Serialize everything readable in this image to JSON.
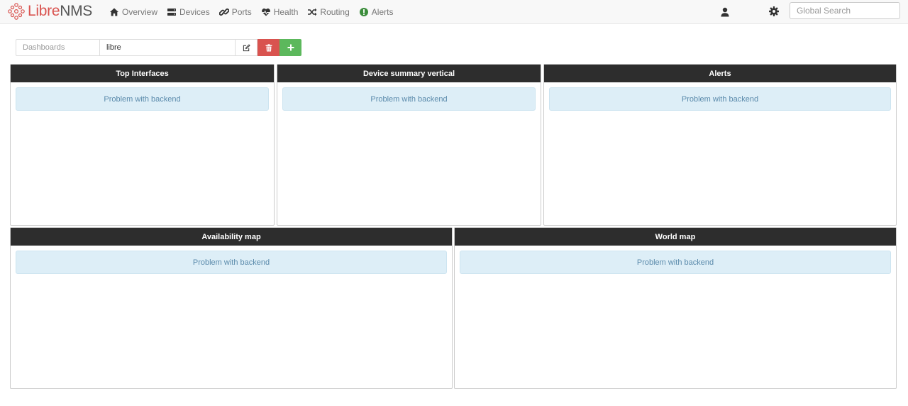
{
  "brand": {
    "part1": "Libre",
    "part2": "NMS"
  },
  "nav": [
    {
      "label": "Overview",
      "icon": "home-icon"
    },
    {
      "label": "Devices",
      "icon": "server-icon"
    },
    {
      "label": "Ports",
      "icon": "link-icon"
    },
    {
      "label": "Health",
      "icon": "heartbeat-icon"
    },
    {
      "label": "Routing",
      "icon": "random-icon"
    },
    {
      "label": "Alerts",
      "icon": "exclamation-circle-icon"
    }
  ],
  "search": {
    "placeholder": "Global Search"
  },
  "dashboard": {
    "label": "Dashboards",
    "selected": "libre"
  },
  "widgets": [
    {
      "title": "Top Interfaces",
      "message": "Problem with backend"
    },
    {
      "title": "Device summary vertical",
      "message": "Problem with backend"
    },
    {
      "title": "Alerts",
      "message": "Problem with backend"
    },
    {
      "title": "Availability map",
      "message": "Problem with backend"
    },
    {
      "title": "World map",
      "message": "Problem with backend"
    }
  ],
  "colors": {
    "danger": "#d9534f",
    "success": "#5cb85c",
    "header": "#2d2d2d",
    "info_bg": "#ddeef7"
  }
}
